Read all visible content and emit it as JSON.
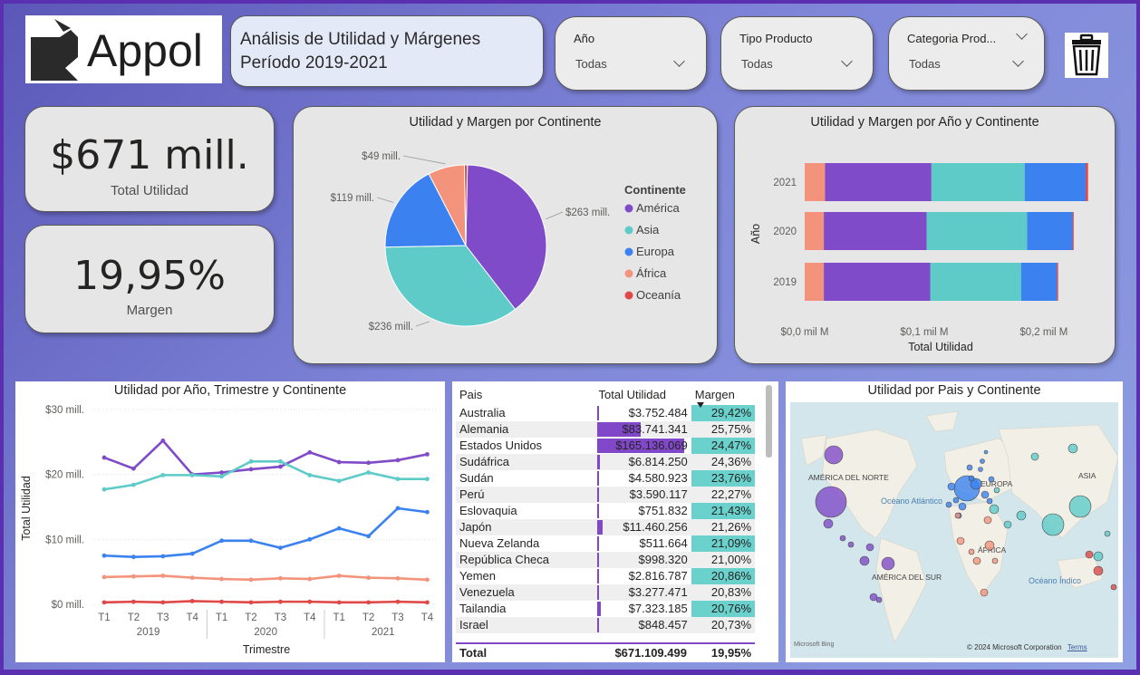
{
  "logo": {
    "text": "Appol"
  },
  "header": {
    "title_line1": "Análisis de Utilidad y Márgenes",
    "title_line2": "Período 2019-2021"
  },
  "slicers": [
    {
      "label": "Año",
      "value": "Todas"
    },
    {
      "label": "Tipo Producto",
      "value": "Todas"
    },
    {
      "label": "Categoria Prod...",
      "value": "Todas"
    }
  ],
  "icons": {
    "clear": "trash-icon",
    "dropdown": "chevron-down-icon",
    "sort": "sort-desc-icon"
  },
  "kpis": {
    "utilidad": {
      "value": "$671 mill.",
      "label": "Total Utilidad"
    },
    "margen": {
      "value": "19,95%",
      "label": "Margen"
    }
  },
  "colors": {
    "America": "#7f4bc8",
    "Asia": "#5ecbc8",
    "Europa": "#3b82f0",
    "Africa": "#f4937c",
    "Oceania": "#e04848"
  },
  "chart_data": [
    {
      "type": "pie",
      "title": "Utilidad y Margen por Continente",
      "legend_title": "Continente",
      "legend_position": "right",
      "labels": [
        "América",
        "Asia",
        "Europa",
        "África",
        "Oceanía"
      ],
      "values": [
        263,
        236,
        119,
        49,
        4
      ],
      "data_labels": [
        "$263 mill.",
        "$236 mill.",
        "$119 mill.",
        "$49 mill.",
        ""
      ]
    },
    {
      "type": "bar",
      "orientation": "horizontal",
      "stacked": true,
      "title": "Utilidad y Margen por Año y Continente",
      "xlabel": "Total Utilidad",
      "ylabel": "Año",
      "categories": [
        "2021",
        "2020",
        "2019"
      ],
      "xlim": [
        0,
        0.26
      ],
      "xticks": [
        "$0,0 mil M",
        "$0,1 mil M",
        "$0,2 mil M"
      ],
      "series": [
        {
          "name": "África",
          "values": [
            0.017,
            0.016,
            0.016
          ]
        },
        {
          "name": "América",
          "values": [
            0.089,
            0.086,
            0.089
          ]
        },
        {
          "name": "Asia",
          "values": [
            0.078,
            0.084,
            0.076
          ]
        },
        {
          "name": "Europa",
          "values": [
            0.051,
            0.038,
            0.03
          ]
        },
        {
          "name": "Oceanía",
          "values": [
            0.002,
            0.001,
            0.001
          ]
        }
      ]
    },
    {
      "type": "line",
      "title": "Utilidad por Año, Trimestre y Continente",
      "xlabel": "Trimestre",
      "ylabel": "Total Utilidad",
      "x": [
        "T1",
        "T2",
        "T3",
        "T4",
        "T1",
        "T2",
        "T3",
        "T4",
        "T1",
        "T2",
        "T3",
        "T4"
      ],
      "x_groups": [
        {
          "label": "2019",
          "count": 4
        },
        {
          "label": "2020",
          "count": 4
        },
        {
          "label": "2021",
          "count": 4
        }
      ],
      "ylim": [
        0,
        30
      ],
      "yticks": [
        "$0 mill.",
        "$10 mill.",
        "$20 mill.",
        "$30 mill."
      ],
      "series": [
        {
          "name": "América",
          "values": [
            22.6,
            20.9,
            25.2,
            20.0,
            20.3,
            20.8,
            21.2,
            23.4,
            21.9,
            21.8,
            22.2,
            23.1
          ]
        },
        {
          "name": "Asia",
          "values": [
            17.7,
            18.4,
            19.9,
            19.9,
            19.7,
            22.0,
            22.0,
            19.9,
            19.0,
            20.3,
            19.3,
            19.3
          ]
        },
        {
          "name": "Europa",
          "values": [
            7.5,
            7.3,
            7.4,
            7.8,
            9.8,
            9.8,
            8.7,
            10.0,
            11.7,
            10.5,
            14.8,
            14.2
          ]
        },
        {
          "name": "África",
          "values": [
            4.2,
            4.3,
            4.4,
            4.1,
            3.9,
            3.8,
            4.0,
            3.9,
            4.4,
            4.1,
            4.0,
            3.8
          ]
        },
        {
          "name": "Oceanía",
          "values": [
            0.3,
            0.4,
            0.3,
            0.5,
            0.4,
            0.3,
            0.4,
            0.4,
            0.3,
            0.3,
            0.4,
            0.3
          ]
        }
      ]
    },
    {
      "type": "table",
      "columns": [
        "Pais",
        "Total Utilidad",
        "Margen"
      ],
      "rows": [
        {
          "pais": "Australia",
          "utilidad": "$3.752.484",
          "margen": "29,42%",
          "value": 3752484
        },
        {
          "pais": "Alemania",
          "utilidad": "$83.741.341",
          "margen": "25,75%",
          "value": 83741341
        },
        {
          "pais": "Estados Unidos",
          "utilidad": "$165.136.069",
          "margen": "24,47%",
          "value": 165136069
        },
        {
          "pais": "Sudáfrica",
          "utilidad": "$6.814.250",
          "margen": "24,36%",
          "value": 6814250
        },
        {
          "pais": "Sudán",
          "utilidad": "$4.580.923",
          "margen": "23,76%",
          "value": 4580923
        },
        {
          "pais": "Perú",
          "utilidad": "$3.590.117",
          "margen": "22,27%",
          "value": 3590117
        },
        {
          "pais": "Eslovaquia",
          "utilidad": "$751.832",
          "margen": "21,43%",
          "value": 751832
        },
        {
          "pais": "Japón",
          "utilidad": "$11.460.256",
          "margen": "21,26%",
          "value": 11460256
        },
        {
          "pais": "Nueva Zelanda",
          "utilidad": "$511.664",
          "margen": "21,09%",
          "value": 511664
        },
        {
          "pais": "República Checa",
          "utilidad": "$998.320",
          "margen": "21,00%",
          "value": 998320
        },
        {
          "pais": "Yemen",
          "utilidad": "$2.816.787",
          "margen": "20,86%",
          "value": 2816787
        },
        {
          "pais": "Venezuela",
          "utilidad": "$3.277.471",
          "margen": "20,83%",
          "value": 3277471
        },
        {
          "pais": "Tailandia",
          "utilidad": "$7.323.185",
          "margen": "20,76%",
          "value": 7323185
        },
        {
          "pais": "Israel",
          "utilidad": "$848.457",
          "margen": "20,73%",
          "value": 848457
        }
      ],
      "total": {
        "pais": "Total",
        "utilidad": "$671.109.499",
        "margen": "19,95%"
      }
    }
  ],
  "map": {
    "title": "Utilidad por Pais y Continente",
    "labels": [
      "AMÉRICA DEL NORTE",
      "EUROPA",
      "ASIA",
      "Océano Atlántico",
      "ÁFRICA",
      "AMÉRICA DEL SUR",
      "Océano Índico"
    ],
    "attribution": "© 2024 Microsoft Corporation",
    "terms": "Terms",
    "brand": "Microsoft Bing"
  }
}
